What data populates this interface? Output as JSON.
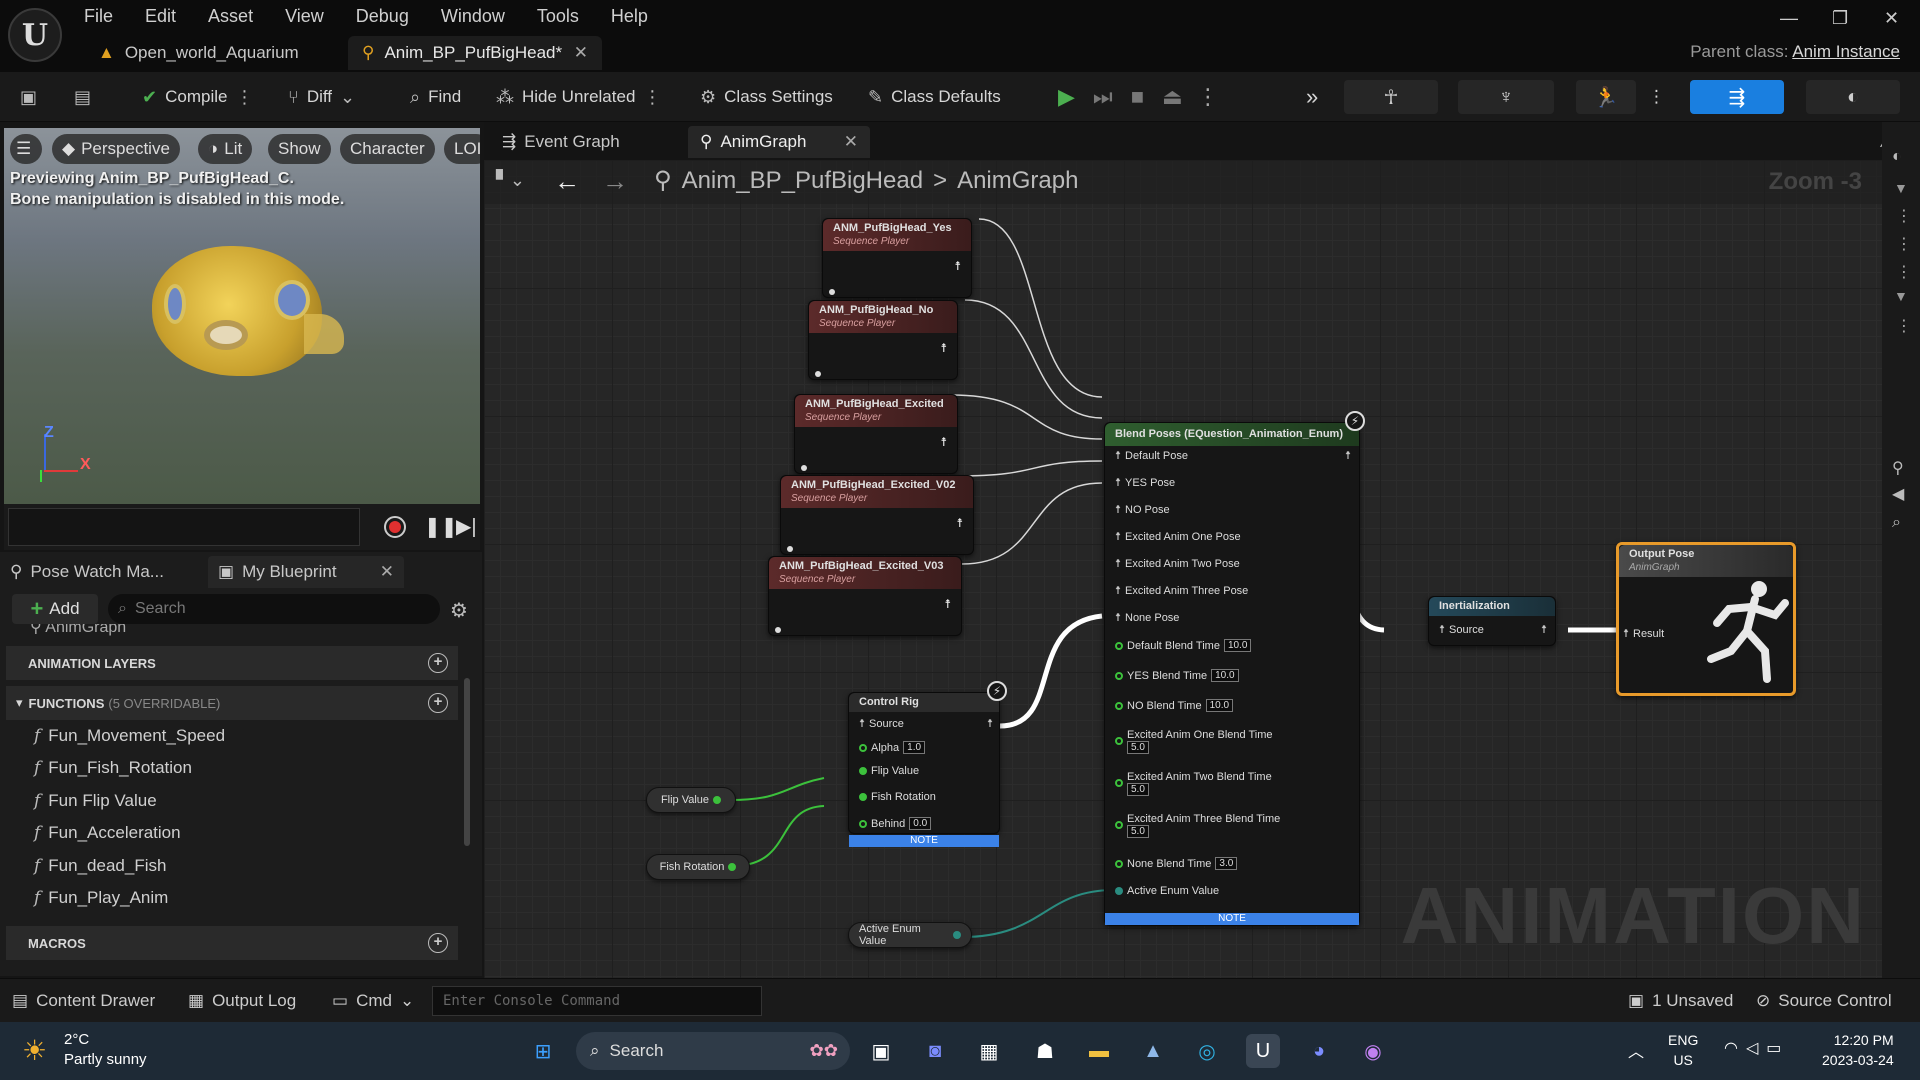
{
  "window": {
    "menu": [
      "File",
      "Edit",
      "Asset",
      "View",
      "Debug",
      "Window",
      "Tools",
      "Help"
    ],
    "tabs": [
      {
        "label": "Open_world_Aquarium"
      },
      {
        "label": "Anim_BP_PufBigHead*"
      }
    ],
    "parent_class_label": "Parent class:",
    "parent_class_value": "Anim Instance"
  },
  "toolbar": {
    "compile": "Compile",
    "diff": "Diff",
    "find": "Find",
    "hide_unrelated": "Hide Unrelated",
    "class_settings": "Class Settings",
    "class_defaults": "Class Defaults"
  },
  "viewport": {
    "perspective": "Perspective",
    "lit": "Lit",
    "show": "Show",
    "character": "Character",
    "lod": "LOI",
    "msg_line1": "Previewing Anim_BP_PufBigHead_C.",
    "msg_line2": "Bone manipulation is disabled in this mode.",
    "axis_z": "Z",
    "axis_x": "X"
  },
  "left_panel": {
    "tab_pose_watch": "Pose Watch Ma...",
    "tab_my_blueprint": "My Blueprint",
    "add": "Add",
    "search_placeholder": "Search",
    "truncated_item": "AnimGraph",
    "section_anim_layers": "ANIMATION LAYERS",
    "section_functions": "FUNCTIONS",
    "functions_sub": "(5 OVERRIDABLE)",
    "functions": [
      "Fun_Movement_Speed",
      "Fun_Fish_Rotation",
      "Fun Flip Value",
      "Fun_Acceleration",
      "Fun_dead_Fish",
      "Fun_Play_Anim"
    ],
    "section_macros": "MACROS"
  },
  "graph_tabs": {
    "event_graph": "Event Graph",
    "anim_graph": "AnimGraph"
  },
  "breadcrumb": {
    "blueprint": "Anim_BP_PufBigHead",
    "sep": ">",
    "graph": "AnimGraph",
    "zoom": "Zoom -3"
  },
  "nodes": {
    "seq_sub": "Sequence Player",
    "seq": [
      "ANM_PufBigHead_Yes",
      "ANM_PufBigHead_No",
      "ANM_PufBigHead_Excited",
      "ANM_PufBigHead_Excited_V02",
      "ANM_PufBigHead_Excited_V03"
    ],
    "blend_title": "Blend Poses (EQuestion_Animation_Enum)",
    "blend_pose_pins": [
      "Default Pose",
      "YES Pose",
      "NO Pose",
      "Excited Anim One Pose",
      "Excited Anim Two Pose",
      "Excited Anim Three Pose",
      "None Pose"
    ],
    "blend_times": [
      {
        "label": "Default Blend Time",
        "value": "10.0"
      },
      {
        "label": "YES Blend Time",
        "value": "10.0"
      },
      {
        "label": "NO Blend Time",
        "value": "10.0"
      },
      {
        "label": "Excited Anim One Blend Time",
        "value": "5.0"
      },
      {
        "label": "Excited Anim Two Blend Time",
        "value": "5.0"
      },
      {
        "label": "Excited Anim Three Blend Time",
        "value": "5.0"
      },
      {
        "label": "None Blend Time",
        "value": "3.0"
      }
    ],
    "active_enum": "Active Enum Value",
    "note": "NOTE",
    "control_rig": "Control Rig",
    "cr_source": "Source",
    "cr_alpha": "Alpha",
    "cr_alpha_val": "1.0",
    "cr_flip": "Flip Value",
    "cr_fish_rot": "Fish Rotation",
    "cr_behind": "Behind",
    "cr_behind_val": "0.0",
    "var_flip": "Flip Value",
    "var_fish_rot": "Fish Rotation",
    "var_active_enum": "Active Enum Value",
    "inert_title": "Inertialization",
    "inert_source": "Source",
    "output_title": "Output Pose",
    "output_sub": "AnimGraph",
    "output_result": "Result",
    "watermark": "ANIMATION"
  },
  "bottom_bar": {
    "content_drawer": "Content Drawer",
    "output_log": "Output Log",
    "cmd": "Cmd",
    "console_placeholder": "Enter Console Command",
    "unsaved": "1 Unsaved",
    "source_control": "Source Control"
  },
  "taskbar": {
    "weather_temp": "2°C",
    "weather_desc": "Partly sunny",
    "search": "Search",
    "lang1": "ENG",
    "lang2": "US",
    "time": "12:20 PM",
    "date": "2023-03-24"
  },
  "colors": {
    "accent_blue": "#1a7fe0",
    "output_border": "#e89a2a",
    "exec_wire": "#ffffff",
    "float_pin": "#3cc13c"
  }
}
